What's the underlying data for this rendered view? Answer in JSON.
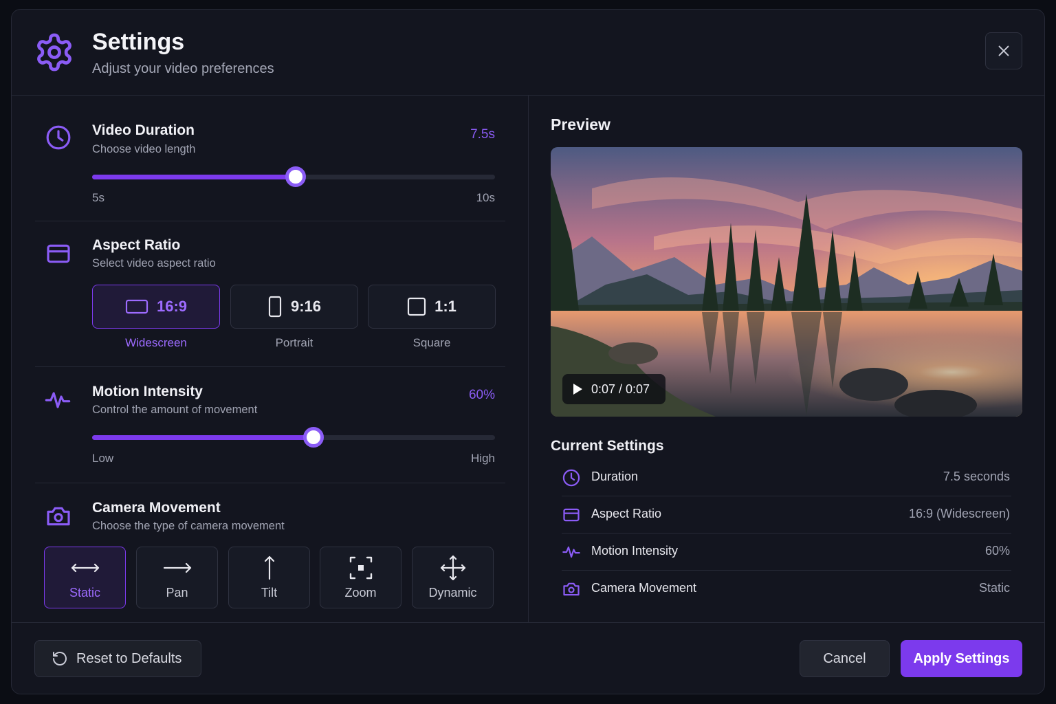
{
  "header": {
    "title": "Settings",
    "subtitle": "Adjust your video preferences",
    "icon": "gear-icon",
    "close_icon": "close-icon"
  },
  "duration": {
    "title": "Video Duration",
    "subtitle": "Choose video length",
    "value_label": "7.5s",
    "min_label": "5s",
    "max_label": "10s",
    "min": 5,
    "max": 10,
    "value": 7.5
  },
  "aspect_ratio": {
    "title": "Aspect Ratio",
    "subtitle": "Select video aspect ratio",
    "options": [
      {
        "label": "16:9",
        "caption": "Widescreen",
        "icon": "widescreen-icon",
        "selected": true
      },
      {
        "label": "9:16",
        "caption": "Portrait",
        "icon": "portrait-icon",
        "selected": false
      },
      {
        "label": "1:1",
        "caption": "Square",
        "icon": "square-icon",
        "selected": false
      }
    ]
  },
  "motion": {
    "title": "Motion Intensity",
    "subtitle": "Control the amount of movement",
    "value_label": "60%",
    "min_label": "Low",
    "max_label": "High",
    "value_percent": 55
  },
  "camera": {
    "title": "Camera Movement",
    "subtitle": "Choose the type of camera movement",
    "options": [
      {
        "label": "Static",
        "icon": "horizontal-arrows-icon",
        "selected": true
      },
      {
        "label": "Pan",
        "icon": "arrow-right-icon",
        "selected": false
      },
      {
        "label": "Tilt",
        "icon": "arrow-up-icon",
        "selected": false
      },
      {
        "label": "Zoom",
        "icon": "focus-icon",
        "selected": false
      },
      {
        "label": "Dynamic",
        "icon": "move-icon",
        "selected": false
      }
    ]
  },
  "preview": {
    "title": "Preview",
    "time": "0:07 / 0:07"
  },
  "current_settings": {
    "title": "Current Settings",
    "rows": [
      {
        "label": "Duration",
        "value": "7.5 seconds",
        "icon": "clock-icon"
      },
      {
        "label": "Aspect Ratio",
        "value": "16:9 (Widescreen)",
        "icon": "aspect-icon"
      },
      {
        "label": "Motion Intensity",
        "value": "60%",
        "icon": "pulse-icon"
      },
      {
        "label": "Camera Movement",
        "value": "Static",
        "icon": "camera-icon"
      }
    ]
  },
  "footer": {
    "reset_label": "Reset to Defaults",
    "cancel_label": "Cancel",
    "apply_label": "Apply Settings"
  },
  "colors": {
    "accent": "#7c3aed",
    "accent_light": "#8b5cf6",
    "background": "#13151f"
  }
}
